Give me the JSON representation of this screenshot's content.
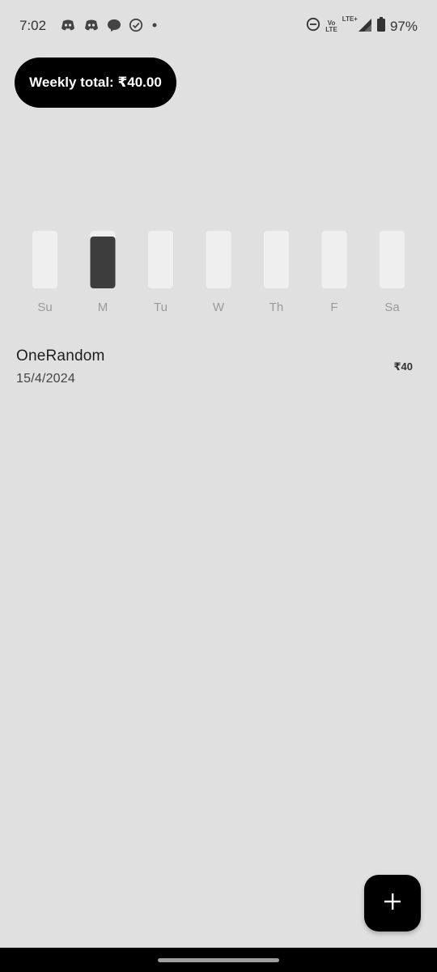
{
  "status_bar": {
    "time": "7:02",
    "notification_icons": [
      "discord-icon",
      "discord-icon",
      "chat-bubble-icon",
      "check-circle-icon",
      "dot-icon"
    ],
    "network": {
      "volte_top": "Vo",
      "volte_bottom": "LTE",
      "lte": "LTE+"
    },
    "battery": "97%"
  },
  "summary": {
    "weekly_total_label": "Weekly total: ₹40.00"
  },
  "chart_data": {
    "type": "bar",
    "categories": [
      "Su",
      "M",
      "Tu",
      "W",
      "Th",
      "F",
      "Sa"
    ],
    "values": [
      0,
      40,
      0,
      0,
      0,
      0,
      0
    ],
    "ylim": [
      0,
      40
    ],
    "bar_color": "#3d3d3d",
    "track_color": "#efefef",
    "label_color": "#9a9a9a"
  },
  "entries": [
    {
      "name": "OneRandom",
      "date": "15/4/2024",
      "amount": "₹40"
    }
  ],
  "fab": {
    "icon": "plus-icon"
  }
}
